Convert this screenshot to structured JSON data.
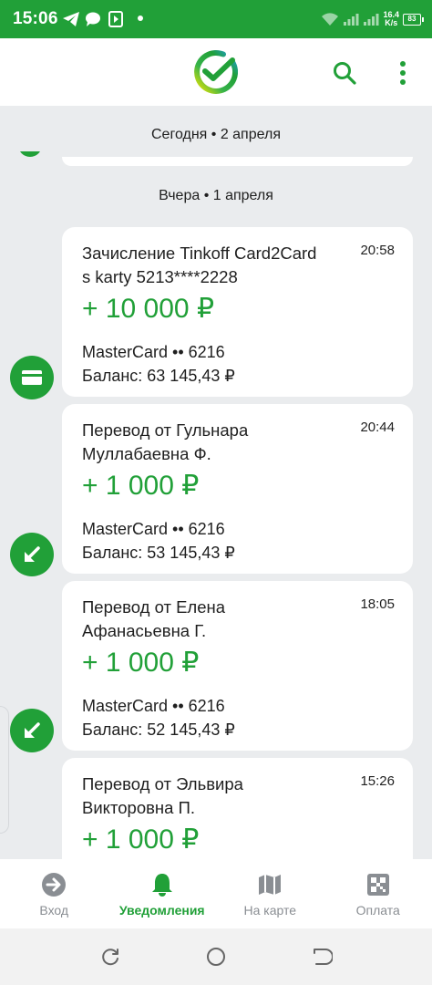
{
  "status_bar": {
    "time": "15:06",
    "net_speed_top": "16.4",
    "net_speed_bottom": "K/s",
    "battery": "83",
    "icons": [
      "telegram-icon",
      "chat-icon",
      "media-icon",
      "dot-icon",
      "wifi-icon",
      "signal-icon",
      "signal-icon",
      "battery-icon"
    ]
  },
  "header": {
    "logo": "sber-logo",
    "icons": [
      "search-icon",
      "more-vertical-icon"
    ]
  },
  "feed": {
    "today_label": "Сегодня • 2 апреля",
    "yesterday_label": "Вчера • 1 апреля",
    "items": [
      {
        "icon": "card-icon",
        "title_line1": "Зачисление Tinkoff Card2Card",
        "title_line2": "s karty 5213****2228",
        "time": "20:58",
        "amount": "+ 10 000 ₽",
        "card": "MasterCard •• 6216",
        "balance": "Баланс: 63 145,43 ₽"
      },
      {
        "icon": "incoming-arrow-icon",
        "title_line1": "Перевод от Гульнара",
        "title_line2": "Муллабаевна Ф.",
        "time": "20:44",
        "amount": "+ 1 000 ₽",
        "card": "MasterCard •• 6216",
        "balance": "Баланс: 53 145,43 ₽"
      },
      {
        "icon": "incoming-arrow-icon",
        "title_line1": "Перевод от Елена",
        "title_line2": "Афанасьевна Г.",
        "time": "18:05",
        "amount": "+ 1 000 ₽",
        "card": "MasterCard •• 6216",
        "balance": "Баланс: 52 145,43 ₽"
      },
      {
        "icon": "incoming-arrow-icon",
        "title_line1": "Перевод от Эльвира",
        "title_line2": "Викторовна П.",
        "time": "15:26",
        "amount": "+ 1 000 ₽",
        "card": "",
        "balance": ""
      }
    ]
  },
  "bottom_nav": {
    "items": [
      {
        "label": "Вход",
        "icon": "login-icon",
        "active": false
      },
      {
        "label": "Уведомления",
        "icon": "bell-icon",
        "active": true
      },
      {
        "label": "На карте",
        "icon": "map-icon",
        "active": false
      },
      {
        "label": "Оплата",
        "icon": "qr-icon",
        "active": false
      }
    ]
  },
  "system_nav": [
    "recent-apps-icon",
    "home-icon",
    "back-icon"
  ],
  "colors": {
    "brand_green": "#21a038",
    "background": "#eaecee",
    "inactive_grey": "#8a8e93"
  }
}
